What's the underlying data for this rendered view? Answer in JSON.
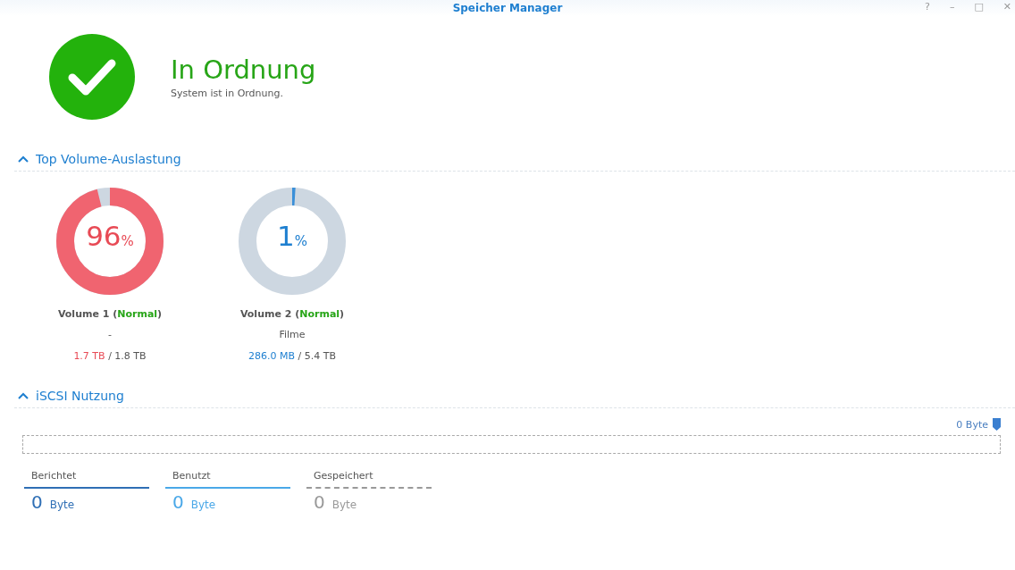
{
  "window": {
    "title": "Speicher Manager",
    "controls": [
      "?",
      "–",
      "□",
      "✕"
    ]
  },
  "status": {
    "ok": true,
    "title": "In Ordnung",
    "message": "System ist in Ordnung."
  },
  "volume_section": {
    "heading": "Top Volume-Auslastung",
    "expanded": true,
    "volumes": [
      {
        "percent": "96",
        "percent_sign": "%",
        "level": 0.96,
        "critical": true,
        "name": "Volume 1 (",
        "status": "Normal",
        "name_end": ")",
        "description": "-",
        "used": "1.7 TB",
        "separator": "/",
        "total": "1.8 TB"
      },
      {
        "percent": "1",
        "percent_sign": "%",
        "level": 0.01,
        "critical": false,
        "name": "Volume 2 (",
        "status": "Normal",
        "name_end": ")",
        "description": "Filme",
        "used": "286.0 MB",
        "separator": "/",
        "total": "5.4 TB"
      }
    ]
  },
  "iscsi_section": {
    "heading": "iSCSI Nutzung",
    "expanded": true,
    "bar_marker": "0 Byte",
    "stats": [
      {
        "label": "Berichtet",
        "value": "0",
        "unit": "Byte",
        "color": "#2f6fb5",
        "kind": "solid"
      },
      {
        "label": "Benutzt",
        "value": "0",
        "unit": "Byte",
        "color": "#4aa8e8",
        "kind": "solid"
      },
      {
        "label": "Gespeichert",
        "value": "0",
        "unit": "Byte",
        "color": "#999999",
        "kind": "dashed"
      }
    ]
  }
}
